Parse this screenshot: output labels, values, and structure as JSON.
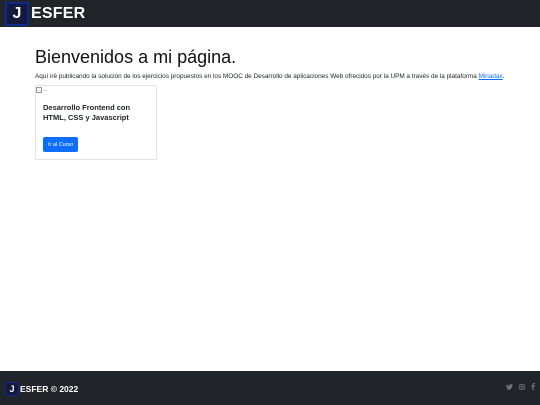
{
  "header": {
    "logo_letter": "J",
    "logo_rest": "ESFER"
  },
  "main": {
    "title": "Bienvenidos a mi página.",
    "intro_text": "Aquí iré publicando la solución de los ejercicios propuestos en los MOOC de Desarrollo de aplicaciones Web ofrecidos por la UPM a través de la plataforma ",
    "intro_link": "Miriadax",
    "intro_end": "."
  },
  "card": {
    "image_alt": "...",
    "title": "Desarrollo Frontend con HTML, CSS y Javascript",
    "button_label": "Ir al Curso"
  },
  "footer": {
    "logo_letter": "J",
    "text": "ESFER © 2022",
    "social_icons": [
      "twitter-icon",
      "instagram-icon",
      "facebook-icon"
    ],
    "icon_color": "#6c757d"
  },
  "colors": {
    "navbar_bg": "#212529",
    "primary": "#0d6efd"
  }
}
